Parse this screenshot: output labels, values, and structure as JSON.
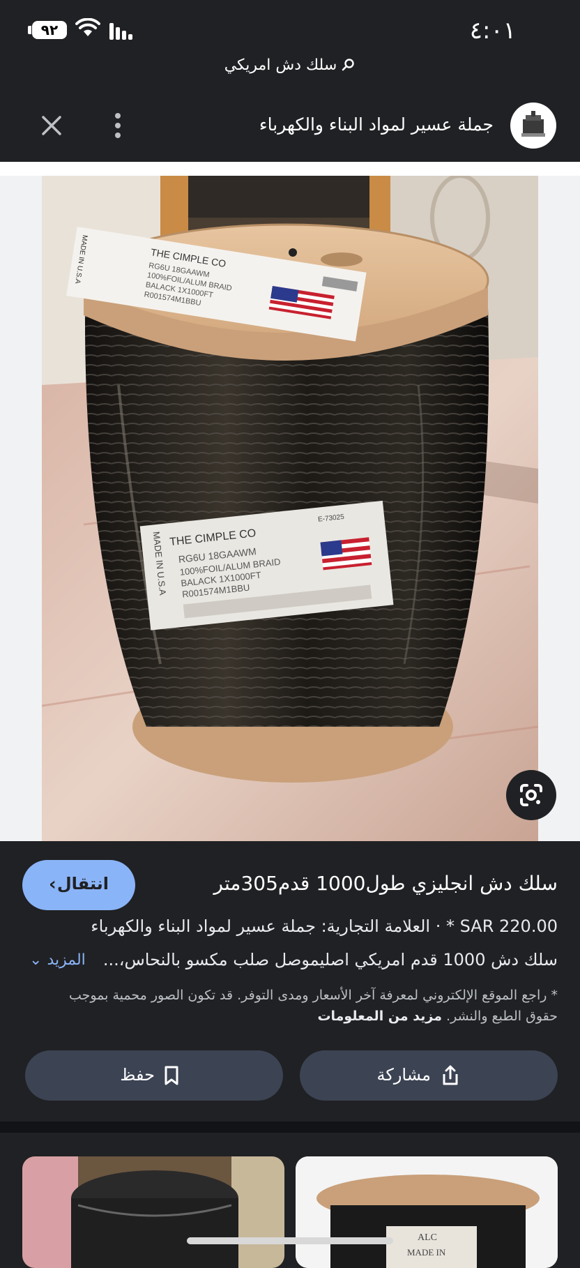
{
  "status_bar": {
    "time": "٤:٠١",
    "battery": "٩٢"
  },
  "search": {
    "query": "سلك دش امريكي"
  },
  "header": {
    "site_name": "جملة عسير لمواد البناء والكهرباء"
  },
  "photo_labels": {
    "top_label_brand": "THE CIMPLE CO",
    "top_label_line1": "RG6U 18GAAWM",
    "top_label_line2": "100%FOIL/ALUM BRAID",
    "top_label_line3": "BALACK 1X1000FT",
    "top_label_line4": "R001574M1BBU",
    "front_label_origin": "MADE IN U.S.A",
    "front_label_brand": "THE CIMPLE CO",
    "front_label_line1": "RG6U 18GAAWM",
    "front_label_line2": "100%FOIL/ALUM BRAID",
    "front_label_line3": "BALACK 1X1000FT",
    "front_label_line4": "R001574M1BBU",
    "front_label_code": "E-73025"
  },
  "result": {
    "title": "سلك دش انجليزي طول1000 قدم305متر",
    "price": "SAR 220.00",
    "brand_line": "* · العلامة التجارية: جملة عسير لمواد البناء والكهرباء",
    "description": "سلك دش 1000 قدم امريكي اصليموصل صلب مكسو بالنحاس،...",
    "more_label": "المزيد",
    "disclaimer": "* راجع الموقع الإلكتروني لمعرفة آخر الأسعار ومدى التوفر. قد تكون الصور محمية بموجب حقوق الطبع والنشر.",
    "more_info_label": "مزيد من المعلومات",
    "visit_label": "انتقال",
    "share_label": "مشاركة",
    "save_label": "حفظ"
  },
  "more_results": {
    "thumb2_label_line1": "ALC",
    "thumb2_label_line2": "MADE IN"
  },
  "colors": {
    "background": "#202124",
    "accent": "#8ab4f8",
    "button_bg": "#3c4353"
  }
}
